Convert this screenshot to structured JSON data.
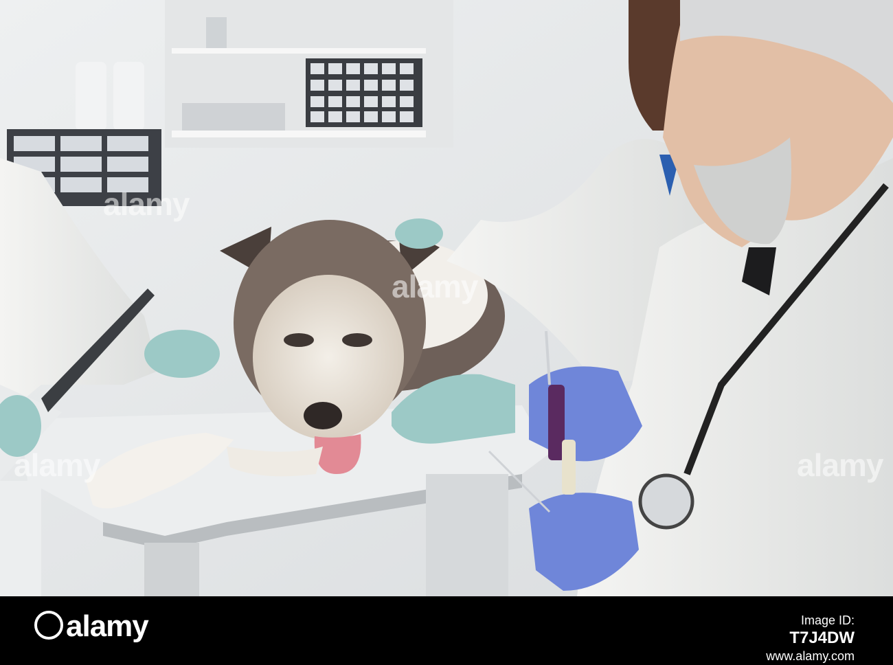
{
  "photo": {
    "subject": "veterinarians-examining-malamute-dog",
    "watermark_text": "alamy"
  },
  "footer": {
    "logo_text": "alamy",
    "image_id_label": "Image ID:",
    "image_id": "T7J4DW",
    "site": "www.alamy.com"
  }
}
